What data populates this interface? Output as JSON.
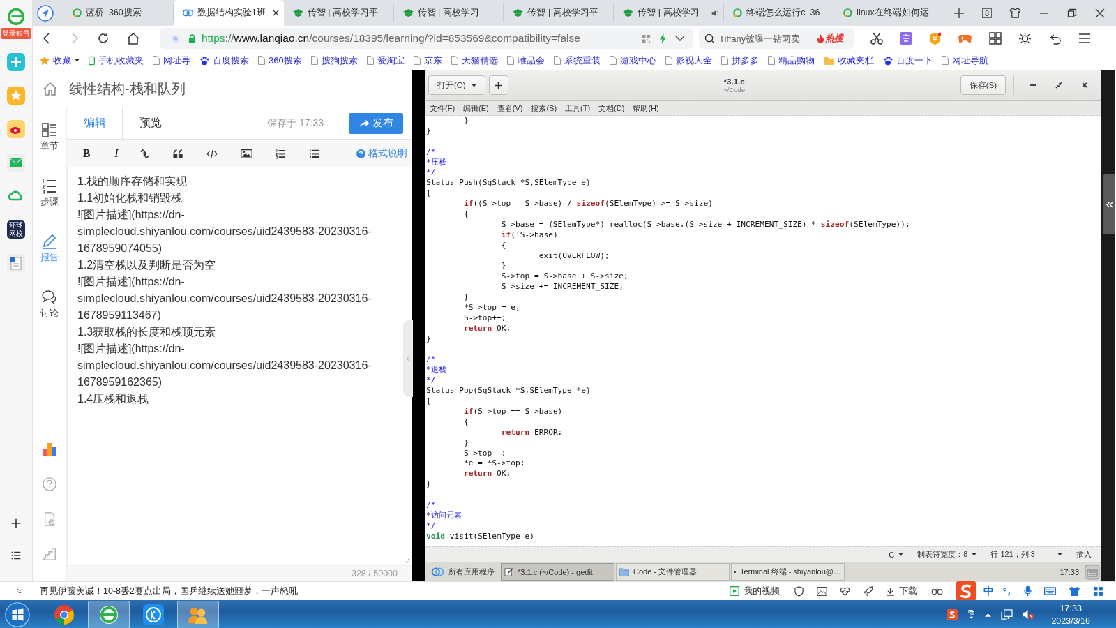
{
  "sidebar_360": {
    "login_badge": "登录账号",
    "news_app_label": "环球网校"
  },
  "browser": {
    "tabs": [
      {
        "kind": "search",
        "title": "蓝桥_360搜索",
        "selected": false,
        "audio": false
      },
      {
        "kind": "course",
        "title": "数据结构实验1班",
        "selected": true,
        "audio": false
      },
      {
        "kind": "school",
        "title": "传智 | 高校学习平",
        "selected": false,
        "audio": false
      },
      {
        "kind": "school",
        "title": "传智 | 高校学习",
        "selected": false,
        "audio": false
      },
      {
        "kind": "school",
        "title": "传智 | 高校学习平",
        "selected": false,
        "audio": false
      },
      {
        "kind": "school",
        "title": "传智 | 高校学习",
        "selected": false,
        "audio": true
      },
      {
        "kind": "search",
        "title": "终端怎么运行c_36",
        "selected": false,
        "audio": false
      },
      {
        "kind": "search",
        "title": "linux在终端如何运",
        "selected": false,
        "audio": false
      }
    ],
    "tab_count": "8",
    "address": {
      "scheme": "https",
      "separator": "://",
      "host": "www.lanqiao.cn",
      "path": "/courses/18395/learning/?id=853569&compatibility=false"
    },
    "search": {
      "placeholder": "Tiffany被曝一钻两卖",
      "hot_label": "热搜"
    },
    "bookmarks": [
      {
        "kind": "star",
        "label": "收藏"
      },
      {
        "kind": "phone",
        "label": "手机收藏夹"
      },
      {
        "kind": "page",
        "label": "网址导"
      },
      {
        "kind": "paw",
        "label": "百度搜索"
      },
      {
        "kind": "page",
        "label": "360搜索"
      },
      {
        "kind": "page",
        "label": "搜狗搜索"
      },
      {
        "kind": "page",
        "label": "爱淘宝"
      },
      {
        "kind": "page",
        "label": "京东"
      },
      {
        "kind": "page",
        "label": "天猫精选"
      },
      {
        "kind": "page",
        "label": "唯品会"
      },
      {
        "kind": "page",
        "label": "系统重装"
      },
      {
        "kind": "page",
        "label": "游戏中心"
      },
      {
        "kind": "page",
        "label": "影视大全"
      },
      {
        "kind": "page",
        "label": "拼多多"
      },
      {
        "kind": "page",
        "label": "精品购物"
      },
      {
        "kind": "folder",
        "label": "收藏夹栏"
      },
      {
        "kind": "paw",
        "label": "百度一下"
      },
      {
        "kind": "page",
        "label": "网址导航"
      }
    ]
  },
  "page": {
    "title": "线性结构-栈和队列",
    "rail": [
      {
        "kind": "chapters",
        "label": "章节",
        "selected": false
      },
      {
        "kind": "steps",
        "label": "步骤",
        "selected": false
      },
      {
        "kind": "report",
        "label": "报告",
        "selected": true
      },
      {
        "kind": "discuss",
        "label": "讨论",
        "selected": false
      }
    ],
    "editor_tabs": [
      {
        "label": "编辑",
        "selected": true
      },
      {
        "label": "预览",
        "selected": false
      }
    ],
    "saved_at": "保存于 17:33",
    "publish_label": "发布",
    "bold_label": "B",
    "italic_label": "I",
    "help_label": "格式说明",
    "lines": [
      "1.栈的顺序存储和实现",
      "1.1初始化栈和销毁栈",
      "![图片描述](https://dn-simplecloud.shiyanlou.com/courses/uid2439583-20230316-1678959074055)",
      "1.2清空栈以及判断是否为空",
      "![图片描述](https://dn-simplecloud.shiyanlou.com/courses/uid2439583-20230316-1678959113467)",
      "1.3获取栈的长度和栈顶元素",
      "![图片描述](https://dn-simplecloud.shiyanlou.com/courses/uid2439583-20230316-1678959162365)",
      "1.4压栈和退栈"
    ],
    "counter": "328 / 50000"
  },
  "gedit": {
    "open_label": "打开(O)",
    "title": "*3.1.c",
    "subtitle": "~/Code",
    "save_label": "保存(S)",
    "menu": [
      "文件(F)",
      "编辑(E)",
      "查看(V)",
      "搜索(S)",
      "工具(T)",
      "文档(D)",
      "帮助(H)"
    ],
    "lines": [
      {
        "kind": "code",
        "segments": [
          {
            "kind": "plain",
            "text": "\t}"
          }
        ]
      },
      {
        "kind": "code",
        "segments": [
          {
            "kind": "plain",
            "text": "}"
          }
        ]
      },
      {
        "kind": "blank"
      },
      {
        "kind": "code",
        "segments": [
          {
            "kind": "comment",
            "text": "/*"
          }
        ]
      },
      {
        "kind": "code",
        "segments": [
          {
            "kind": "comment",
            "text": "*压栈"
          }
        ]
      },
      {
        "kind": "code",
        "segments": [
          {
            "kind": "comment",
            "text": "*/"
          }
        ]
      },
      {
        "kind": "code",
        "segments": [
          {
            "kind": "plain",
            "text": "Status Push(SqStack *S,SElemType e)"
          }
        ]
      },
      {
        "kind": "code",
        "segments": [
          {
            "kind": "plain",
            "text": "{"
          }
        ]
      },
      {
        "kind": "code",
        "segments": [
          {
            "kind": "keyword",
            "text": "\tif"
          },
          {
            "kind": "plain",
            "text": "((S->top - S->base) / "
          },
          {
            "kind": "keyword",
            "text": "sizeof"
          },
          {
            "kind": "plain",
            "text": "(SElemType) >= S->size)"
          }
        ]
      },
      {
        "kind": "code",
        "segments": [
          {
            "kind": "plain",
            "text": "\t{"
          }
        ]
      },
      {
        "kind": "code",
        "segments": [
          {
            "kind": "plain",
            "text": "\t\tS->base = (SElemType*) realloc(S->base,(S->size + INCREMENT_SIZE) * "
          },
          {
            "kind": "keyword",
            "text": "sizeof"
          },
          {
            "kind": "plain",
            "text": "(SElemType));"
          }
        ]
      },
      {
        "kind": "code",
        "segments": [
          {
            "kind": "keyword",
            "text": "\t\tif"
          },
          {
            "kind": "plain",
            "text": "(!S->base)"
          }
        ]
      },
      {
        "kind": "code",
        "segments": [
          {
            "kind": "plain",
            "text": "\t\t{"
          }
        ]
      },
      {
        "kind": "code",
        "segments": [
          {
            "kind": "plain",
            "text": "\t\t\texit(OVERFLOW);"
          }
        ]
      },
      {
        "kind": "code",
        "segments": [
          {
            "kind": "plain",
            "text": "\t\t}"
          }
        ]
      },
      {
        "kind": "code",
        "segments": [
          {
            "kind": "plain",
            "text": "\t\tS->top = S->base + S->size;"
          }
        ]
      },
      {
        "kind": "code",
        "segments": [
          {
            "kind": "plain",
            "text": "\t\tS->size += INCREMENT_SIZE;"
          }
        ]
      },
      {
        "kind": "code",
        "segments": [
          {
            "kind": "plain",
            "text": "\t}"
          }
        ]
      },
      {
        "kind": "code",
        "segments": [
          {
            "kind": "plain",
            "text": "\t*S->top = e;"
          }
        ]
      },
      {
        "kind": "code",
        "segments": [
          {
            "kind": "plain",
            "text": "\tS->top++;"
          }
        ]
      },
      {
        "kind": "code",
        "segments": [
          {
            "kind": "keyword",
            "text": "\treturn"
          },
          {
            "kind": "plain",
            "text": " OK;"
          }
        ]
      },
      {
        "kind": "code",
        "segments": [
          {
            "kind": "plain",
            "text": "}"
          }
        ]
      },
      {
        "kind": "blank"
      },
      {
        "kind": "code",
        "segments": [
          {
            "kind": "comment",
            "text": "/*"
          }
        ]
      },
      {
        "kind": "code",
        "segments": [
          {
            "kind": "comment",
            "text": "*退栈"
          }
        ]
      },
      {
        "kind": "code",
        "segments": [
          {
            "kind": "comment",
            "text": "*/"
          }
        ]
      },
      {
        "kind": "code",
        "segments": [
          {
            "kind": "plain",
            "text": "Status Pop(SqStack *S,SElemType *e)"
          }
        ]
      },
      {
        "kind": "code",
        "segments": [
          {
            "kind": "plain",
            "text": "{"
          }
        ]
      },
      {
        "kind": "code",
        "segments": [
          {
            "kind": "keyword",
            "text": "\tif"
          },
          {
            "kind": "plain",
            "text": "(S->top == S->base)"
          }
        ]
      },
      {
        "kind": "code",
        "segments": [
          {
            "kind": "plain",
            "text": "\t{"
          }
        ]
      },
      {
        "kind": "code",
        "segments": [
          {
            "kind": "keyword",
            "text": "\t\treturn"
          },
          {
            "kind": "plain",
            "text": " ERROR;"
          }
        ]
      },
      {
        "kind": "code",
        "segments": [
          {
            "kind": "plain",
            "text": "\t}"
          }
        ]
      },
      {
        "kind": "code",
        "segments": [
          {
            "kind": "plain",
            "text": "\tS->top--;"
          }
        ]
      },
      {
        "kind": "code",
        "segments": [
          {
            "kind": "plain",
            "text": "\t*e = *S->top;"
          }
        ]
      },
      {
        "kind": "code",
        "segments": [
          {
            "kind": "keyword",
            "text": "\treturn"
          },
          {
            "kind": "plain",
            "text": " OK;"
          }
        ]
      },
      {
        "kind": "code",
        "segments": [
          {
            "kind": "plain",
            "text": "}"
          }
        ]
      },
      {
        "kind": "blank"
      },
      {
        "kind": "code",
        "segments": [
          {
            "kind": "comment",
            "text": "/*"
          }
        ]
      },
      {
        "kind": "code",
        "segments": [
          {
            "kind": "comment",
            "text": "*访问元素"
          }
        ]
      },
      {
        "kind": "code",
        "segments": [
          {
            "kind": "comment",
            "text": "*/"
          }
        ]
      },
      {
        "kind": "code",
        "segments": [
          {
            "kind": "type",
            "text": "void"
          },
          {
            "kind": "plain",
            "text": " visit(SElemType e)"
          }
        ]
      }
    ],
    "status": {
      "language": "C",
      "tab_width": "制表符宽度：8",
      "position": "行 121，列 3",
      "mode": "插入"
    }
  },
  "xfce_panel": {
    "apps_menu": "所有应用程序",
    "tasks": [
      {
        "kind": "editor",
        "label": "*3.1.c (~/Code) - gedit",
        "selected": true
      },
      {
        "kind": "folder",
        "label": "Code - 文件管理器",
        "selected": false
      },
      {
        "kind": "terminal",
        "label": "Terminal 终端 - shiyanlou@…",
        "selected": false
      }
    ],
    "clock": "17:33"
  },
  "news_bar": {
    "headline": "再见伊藤美诚！10-8丢2赛点出局，国乒继续送她噩梦，一声怒吼",
    "video_label": "我的视频",
    "download_label": "下载",
    "ime_label": "中"
  },
  "taskbar": {
    "apps": [
      {
        "kind": "chrome",
        "selected": false
      },
      {
        "kind": "browser360",
        "selected": true
      },
      {
        "kind": "kugou",
        "selected": false
      },
      {
        "kind": "qq",
        "selected": true
      }
    ],
    "time": "17:33",
    "date": "2023/3/16"
  }
}
